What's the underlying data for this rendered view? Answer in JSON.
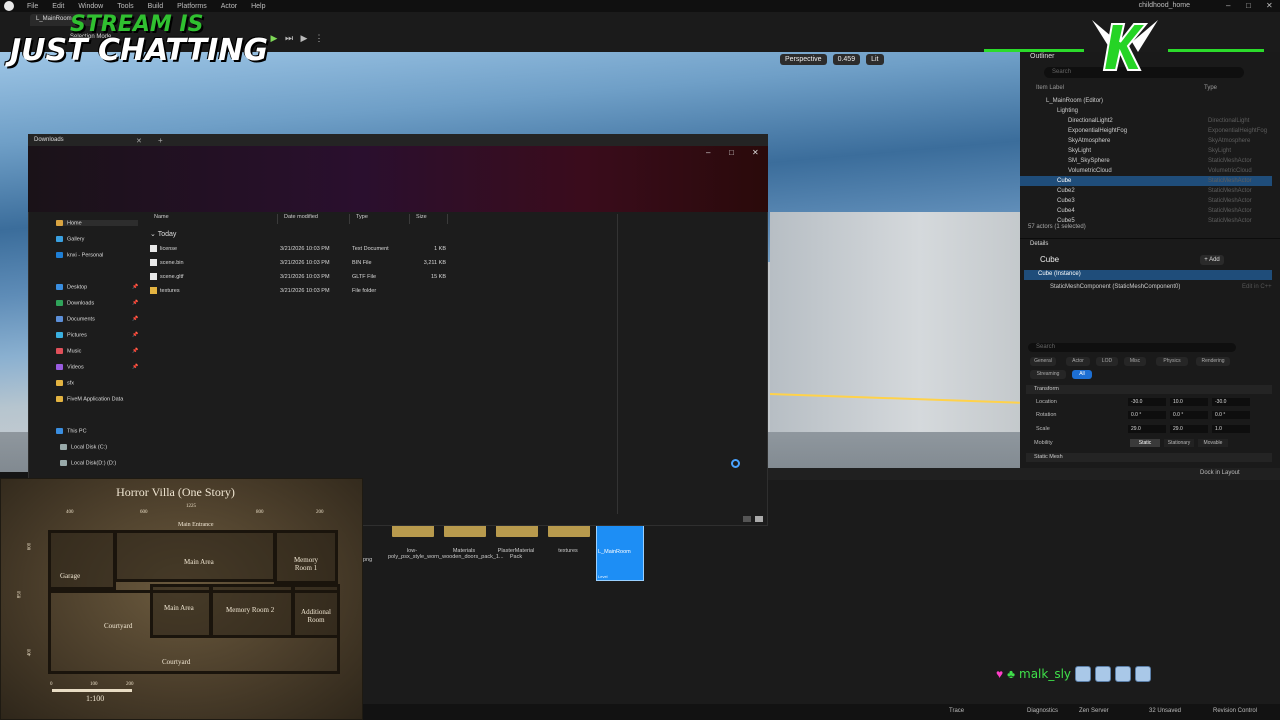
{
  "ue": {
    "menu": [
      "File",
      "Edit",
      "Window",
      "Tools",
      "Build",
      "Platforms",
      "Actor",
      "Help"
    ],
    "project": "childhood_home",
    "tab": "L_MainRoom",
    "mode": "Selection Mode",
    "viewport": {
      "perspective": "Perspective",
      "fov": "0.459",
      "lit": "Lit"
    }
  },
  "stream": {
    "line1": "STREAM IS",
    "line2": "JUST CHATTING"
  },
  "outliner": {
    "tab": "Outliner",
    "search_placeholder": "Search",
    "col_label": "Item Label",
    "col_type": "Type",
    "rows": [
      {
        "label": "L_MainRoom (Editor)",
        "type": "",
        "indent": 2
      },
      {
        "label": "Lighting",
        "type": "",
        "indent": 3
      },
      {
        "label": "DirectionalLight2",
        "type": "DirectionalLight",
        "indent": 4
      },
      {
        "label": "ExponentialHeightFog",
        "type": "ExponentialHeightFog",
        "indent": 4
      },
      {
        "label": "SkyAtmosphere",
        "type": "SkyAtmosphere",
        "indent": 4
      },
      {
        "label": "SkyLight",
        "type": "SkyLight",
        "indent": 4
      },
      {
        "label": "SM_SkySphere",
        "type": "StaticMeshActor",
        "indent": 4
      },
      {
        "label": "VolumetricCloud",
        "type": "VolumetricCloud",
        "indent": 4
      },
      {
        "label": "Cube",
        "type": "StaticMeshActor",
        "indent": 3,
        "selected": true
      },
      {
        "label": "Cube2",
        "type": "StaticMeshActor",
        "indent": 3
      },
      {
        "label": "Cube3",
        "type": "StaticMeshActor",
        "indent": 3
      },
      {
        "label": "Cube4",
        "type": "StaticMeshActor",
        "indent": 3
      },
      {
        "label": "Cube5",
        "type": "StaticMeshActor",
        "indent": 3
      }
    ],
    "footer": "57 actors (1 selected)"
  },
  "details": {
    "tab": "Details",
    "title": "Cube",
    "add_label": "+ Add",
    "instance": "Cube (Instance)",
    "component": "StaticMeshComponent (StaticMeshComponent0)",
    "edit_cpp": "Edit in C++",
    "search_placeholder": "Search",
    "filter_tabs": [
      "General",
      "Actor",
      "LOD",
      "Misc",
      "Physics",
      "Rendering",
      "Streaming",
      "All"
    ],
    "transform_label": "Transform",
    "props": {
      "location": {
        "label": "Location",
        "x": "-30.0",
        "y": "10.0",
        "z": "-30.0"
      },
      "rotation": {
        "label": "Rotation",
        "x": "0.0 °",
        "y": "0.0 °",
        "z": "0.0 °"
      },
      "scale": {
        "label": "Scale",
        "x": "29.0",
        "y": "29.0",
        "z": "1.0"
      }
    },
    "mobility_label": "Mobility",
    "mobility": [
      "Static",
      "Stationary",
      "Movable"
    ],
    "static_mesh_label": "Static Mesh"
  },
  "explorer": {
    "tab": "Downloads",
    "sidebar": [
      {
        "label": "Home",
        "icon": "home-icon",
        "color": "#d9a441"
      },
      {
        "label": "Gallery",
        "icon": "gallery-icon",
        "color": "#3aa0e0"
      },
      {
        "label": "knxi - Personal",
        "icon": "cloud-icon",
        "color": "#1e7fd6"
      },
      {
        "label": "Desktop",
        "icon": "desktop-icon",
        "color": "#3a8ee0"
      },
      {
        "label": "Downloads",
        "icon": "download-icon",
        "color": "#2fa35a"
      },
      {
        "label": "Documents",
        "icon": "document-icon",
        "color": "#5c8fd8"
      },
      {
        "label": "Pictures",
        "icon": "pictures-icon",
        "color": "#3ab0e0"
      },
      {
        "label": "Music",
        "icon": "music-icon",
        "color": "#e0505a"
      },
      {
        "label": "Videos",
        "icon": "video-icon",
        "color": "#9a5ce0"
      },
      {
        "label": "sfx",
        "icon": "folder-icon",
        "color": "#e3b341"
      },
      {
        "label": "FiveM Application Data",
        "icon": "folder-icon",
        "color": "#e3b341"
      },
      {
        "label": "This PC",
        "icon": "pc-icon",
        "color": "#3a8ee0"
      },
      {
        "label": "Local Disk (C:)",
        "icon": "disk-icon",
        "color": "#9aa"
      },
      {
        "label": "Local Disk(D:) (D:)",
        "icon": "disk-icon",
        "color": "#9aa"
      }
    ],
    "columns": [
      "Name",
      "Date modified",
      "Type",
      "Size"
    ],
    "group": "Today",
    "files": [
      {
        "name": "license",
        "date": "3/21/2026 10:03 PM",
        "type": "Text Document",
        "size": "1 KB",
        "icon": "file-icon"
      },
      {
        "name": "scene.bin",
        "date": "3/21/2026 10:03 PM",
        "type": "BIN File",
        "size": "3,211 KB",
        "icon": "file-icon"
      },
      {
        "name": "scene.gltf",
        "date": "3/21/2026 10:03 PM",
        "type": "GLTF File",
        "size": "15 KB",
        "icon": "file-icon"
      },
      {
        "name": "textures",
        "date": "3/21/2026 10:03 PM",
        "type": "File folder",
        "size": "",
        "icon": "folder-icon"
      }
    ]
  },
  "content_browser": {
    "png_label": "png",
    "items": [
      "low-poly_psx_style_worn_wooden_doors_pack_1...",
      "Materials",
      "PlasterMaterial Pack",
      "textures"
    ],
    "level": {
      "name": "L_MainRoom",
      "type": "Level"
    },
    "dock_label": "Dock in Layout"
  },
  "statusbar": [
    "Trace",
    "Diagnostics",
    "Zen Server",
    "32 Unsaved",
    "Revision Control"
  ],
  "map": {
    "title": "Horror Villa (One Story)",
    "labels": [
      "Garage",
      "Main Area",
      "Memory Room 1",
      "Main Entrance",
      "Main Area",
      "Memory Room 2",
      "Additional Room",
      "Courtyard",
      "Courtyard"
    ],
    "ticks_top": [
      "400",
      "600",
      "1225",
      "800",
      "200"
    ],
    "ticks_left": [
      "600",
      "850",
      "400"
    ],
    "ticks_bottom": [
      "0",
      "100",
      "200"
    ],
    "scale": "1:100"
  },
  "chat": {
    "user": "malk_sly"
  }
}
